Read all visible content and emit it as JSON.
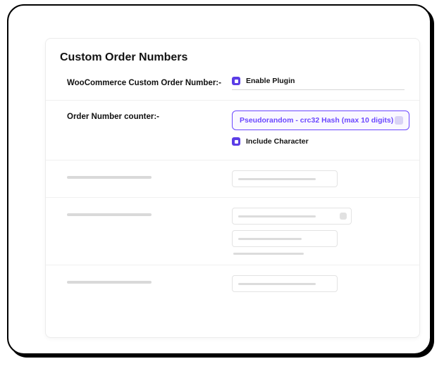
{
  "panel": {
    "title": "Custom Order Numbers"
  },
  "rows": {
    "enable": {
      "label": "WooCommerce Custom Order Number:-",
      "checkbox_label": "Enable Plugin"
    },
    "counter": {
      "label": "Order Number counter:-",
      "select_value": "Pseudorandom - crc32 Hash (max 10 digits)",
      "include_char_label": "Include Character"
    }
  }
}
